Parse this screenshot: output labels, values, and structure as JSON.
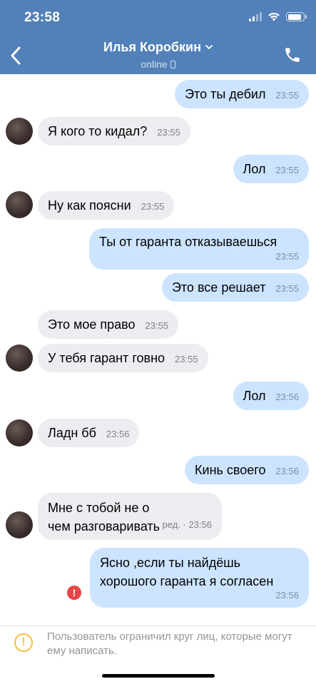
{
  "status_bar": {
    "time": "23:58"
  },
  "header": {
    "contact_name": "Илья Коробкин",
    "contact_status": "online"
  },
  "messages": [
    {
      "dir": "out",
      "text": "Это ты дебил",
      "time": "23:55"
    },
    {
      "dir": "in",
      "text": "Я кого то кидал?",
      "time": "23:55"
    },
    {
      "dir": "out",
      "text": "Лол",
      "time": "23:55"
    },
    {
      "dir": "in",
      "text": "Ну как поясни",
      "time": "23:55"
    },
    {
      "dir": "out",
      "text": "Ты от гаранта отказываешься",
      "time": "23:55"
    },
    {
      "dir": "out",
      "text": "Это все решает",
      "time": "23:55"
    },
    {
      "dir": "in",
      "text": "Это мое право",
      "time": "23:55"
    },
    {
      "dir": "in",
      "text": "У тебя гарант говно",
      "time": "23:55"
    },
    {
      "dir": "out",
      "text": "Лол",
      "time": "23:56"
    },
    {
      "dir": "in",
      "text": "Ладн бб",
      "time": "23:56"
    },
    {
      "dir": "out",
      "text": "Кинь своего",
      "time": "23:56"
    },
    {
      "dir": "in",
      "text": "Мне с тобой не о чем разговаривать",
      "time": "ред. · 23:56"
    },
    {
      "dir": "out",
      "text": "Ясно ,если ты найдёшь хорошого гаранта я согласен",
      "time": "23:56",
      "error": true
    }
  ],
  "footer": {
    "notice": "Пользователь ограничил круг лиц, которые могут ему написать."
  },
  "colors": {
    "header_bg": "#5181b8",
    "outgoing_bubble": "#cce4ff",
    "incoming_bubble": "#ebedf0",
    "error": "#e64646",
    "warning": "#f5c242"
  }
}
